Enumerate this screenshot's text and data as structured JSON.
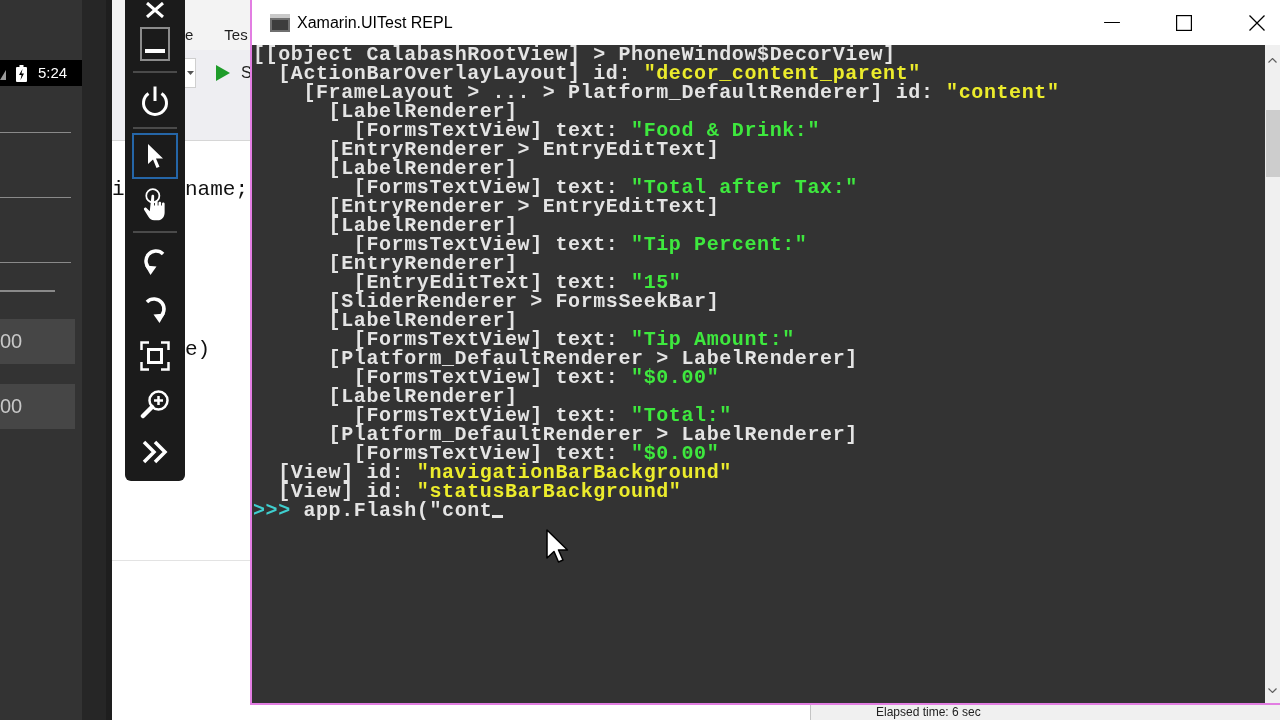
{
  "phone": {
    "status_bar": {
      "time": "5:24"
    },
    "fields": [
      {
        "kind": "entry"
      },
      {
        "kind": "entry"
      },
      {
        "kind": "entry"
      },
      {
        "kind": "slider"
      },
      {
        "kind": "amount",
        "text": "00"
      },
      {
        "kind": "amount",
        "text": "00"
      }
    ]
  },
  "ide": {
    "menu_items": [
      "e",
      "Tes"
    ],
    "run_button": "S",
    "code_lines": [
      {
        "before_toolbar": "i",
        "after_toolbar": "name;"
      },
      {
        "after_toolbar": "e)"
      }
    ]
  },
  "emulator_toolbar": {
    "groups": [
      {
        "tools": [
          {
            "kind": "close",
            "selected": false
          },
          {
            "kind": "minimize",
            "selected": false
          }
        ]
      },
      {
        "tools": [
          {
            "kind": "power",
            "selected": false
          }
        ]
      },
      {
        "tools": [
          {
            "kind": "pointer",
            "selected": true
          },
          {
            "kind": "touch",
            "selected": false
          }
        ]
      },
      {
        "tools": [
          {
            "kind": "rotate_left",
            "selected": false
          },
          {
            "kind": "rotate_right",
            "selected": false
          },
          {
            "kind": "fullscreen",
            "selected": false
          },
          {
            "kind": "zoom",
            "selected": false
          },
          {
            "kind": "more",
            "selected": false
          }
        ]
      }
    ]
  },
  "repl_window": {
    "title": "Xamarin.UITest REPL",
    "output": [
      {
        "label": "[[object CalabashRootView] > PhoneWindow$DecorView]",
        "children": [
          {
            "label": "[ActionBarOverlayLayout] id:",
            "id_value": "\"decor_content_parent\"",
            "children": [
              {
                "label": "[FrameLayout > ... > Platform_DefaultRenderer] id:",
                "id_value": "\"content\"",
                "children": [
                  {
                    "label": "[LabelRenderer]",
                    "children": [
                      {
                        "label": "[FormsTextView] text:",
                        "text_value": "\"Food & Drink:\""
                      }
                    ]
                  },
                  {
                    "label": "[EntryRenderer > EntryEditText]"
                  },
                  {
                    "label": "[LabelRenderer]",
                    "children": [
                      {
                        "label": "[FormsTextView] text:",
                        "text_value": "\"Total after Tax:\""
                      }
                    ]
                  },
                  {
                    "label": "[EntryRenderer > EntryEditText]"
                  },
                  {
                    "label": "[LabelRenderer]",
                    "children": [
                      {
                        "label": "[FormsTextView] text:",
                        "text_value": "\"Tip Percent:\""
                      }
                    ]
                  },
                  {
                    "label": "[EntryRenderer]",
                    "children": [
                      {
                        "label": "[EntryEditText] text:",
                        "text_value": "\"15\""
                      }
                    ]
                  },
                  {
                    "label": "[SliderRenderer > FormsSeekBar]"
                  },
                  {
                    "label": "[LabelRenderer]",
                    "children": [
                      {
                        "label": "[FormsTextView] text:",
                        "text_value": "\"Tip Amount:\""
                      }
                    ]
                  },
                  {
                    "label": "[Platform_DefaultRenderer > LabelRenderer]",
                    "children": [
                      {
                        "label": "[FormsTextView] text:",
                        "text_value": "\"$0.00\""
                      }
                    ]
                  },
                  {
                    "label": "[LabelRenderer]",
                    "children": [
                      {
                        "label": "[FormsTextView] text:",
                        "text_value": "\"Total:\""
                      }
                    ]
                  },
                  {
                    "label": "[Platform_DefaultRenderer > LabelRenderer]",
                    "children": [
                      {
                        "label": "[FormsTextView] text:",
                        "text_value": "\"$0.00\""
                      }
                    ]
                  }
                ]
              }
            ]
          },
          {
            "label": "[View] id:",
            "id_value": "\"navigationBarBackground\""
          },
          {
            "label": "[View] id:",
            "id_value": "\"statusBarBackground\""
          }
        ]
      }
    ],
    "prompt": ">>>",
    "command": "app.Flash(\"cont"
  },
  "status_bar": {
    "text": "Elapsed time: 6 sec"
  }
}
